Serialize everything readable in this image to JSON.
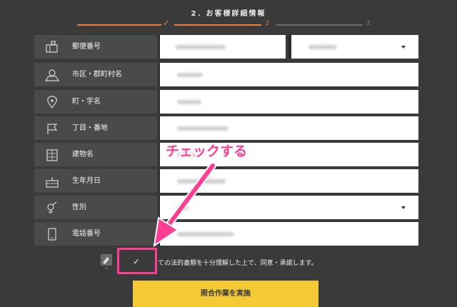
{
  "header": {
    "step_title": "2．お客様詳細情報",
    "steps": [
      {
        "label": "✓"
      },
      {
        "label": "2"
      },
      {
        "label": "3"
      }
    ]
  },
  "form": {
    "rows": [
      {
        "label": "郵便番号",
        "icon": "mailbox-icon"
      },
      {
        "label": "市区・郡町村名",
        "icon": "map-icon"
      },
      {
        "label": "町・字名",
        "icon": "location-pin-icon"
      },
      {
        "label": "丁目・番地",
        "icon": "flag-icon"
      },
      {
        "label": "建物名",
        "icon": "building-icon"
      },
      {
        "label": "生年月日",
        "icon": "cake-icon"
      },
      {
        "label": "性別",
        "icon": "gender-icon"
      },
      {
        "label": "電話番号",
        "icon": "phone-icon"
      }
    ]
  },
  "consent": {
    "checkbox_mark": "✓",
    "text": "ての法的書類を十分理解した上で、同意・承諾します。"
  },
  "submit": {
    "label": "照合作業を実施"
  },
  "annotation": {
    "callout": "チェックする"
  },
  "colors": {
    "background": "#3a3a3a",
    "label_bg": "#4a4a4a",
    "accent_orange": "#e8803a",
    "annotation_pink": "#ff3d93",
    "button_yellow": "#f6c936"
  }
}
